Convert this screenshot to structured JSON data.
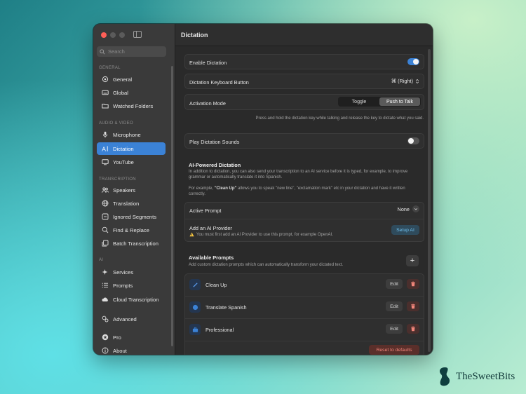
{
  "colors": {
    "accent": "#3b82d6",
    "danger": "#f0857a",
    "link": "#6fc0ee"
  },
  "sidebar": {
    "search_placeholder": "Search",
    "sections": {
      "general": "GENERAL",
      "audio_video": "AUDIO & VIDEO",
      "transcription": "TRANSCRIPTION",
      "ai": "AI"
    },
    "items": {
      "general": "General",
      "global": "Global",
      "watched_folders": "Watched Folders",
      "microphone": "Microphone",
      "dictation": "Dictation",
      "youtube": "YouTube",
      "speakers": "Speakers",
      "translation": "Translation",
      "ignored_segments": "Ignored Segments",
      "find_replace": "Find & Replace",
      "batch_transcription": "Batch Transcription",
      "services": "Services",
      "prompts": "Prompts",
      "cloud_transcription": "Cloud Transcription",
      "advanced": "Advanced",
      "pro": "Pro",
      "about": "About"
    }
  },
  "main": {
    "title": "Dictation",
    "enable_dictation": {
      "label": "Enable Dictation",
      "on": true
    },
    "keyboard_button": {
      "label": "Dictation Keyboard Button",
      "value": "⌘ (Right)"
    },
    "activation_mode": {
      "label": "Activation Mode",
      "options": [
        "Toggle",
        "Push to Talk"
      ],
      "selected": "Push to Talk",
      "help": "Press and hold the dictation key while talking and release the key to dictate what you said."
    },
    "play_sounds": {
      "label": "Play Dictation Sounds",
      "on": false
    },
    "ai_powered": {
      "title": "AI-Powered Dictation",
      "desc1": "In addition to dictation, you can also send your transcription to an AI service before it is typed, for example, to improve grammar or automatically translate it into Spanish.",
      "desc2_prefix": "For example, ",
      "desc2_bold": "\"Clean Up\"",
      "desc2_suffix": " allows you to speak \"new line\", \"exclamation mark\" etc in your dictation and have it written correctly."
    },
    "active_prompt": {
      "label": "Active Prompt",
      "value": "None"
    },
    "ai_provider": {
      "label": "Add an AI Provider",
      "warning": "You must first add an AI Provider to use this prompt, for example OpenAI.",
      "button": "Setup AI"
    },
    "available_prompts": {
      "title": "Available Prompts",
      "desc": "Add custom dictation prompts which can automatically transform your dictated text.",
      "add_label": "+",
      "edit_label": "Edit",
      "items": [
        "Clean Up",
        "Translate Spanish",
        "Professional"
      ],
      "reset_label": "Reset to defaults"
    }
  },
  "brand": {
    "name": "TheSweetBits"
  }
}
